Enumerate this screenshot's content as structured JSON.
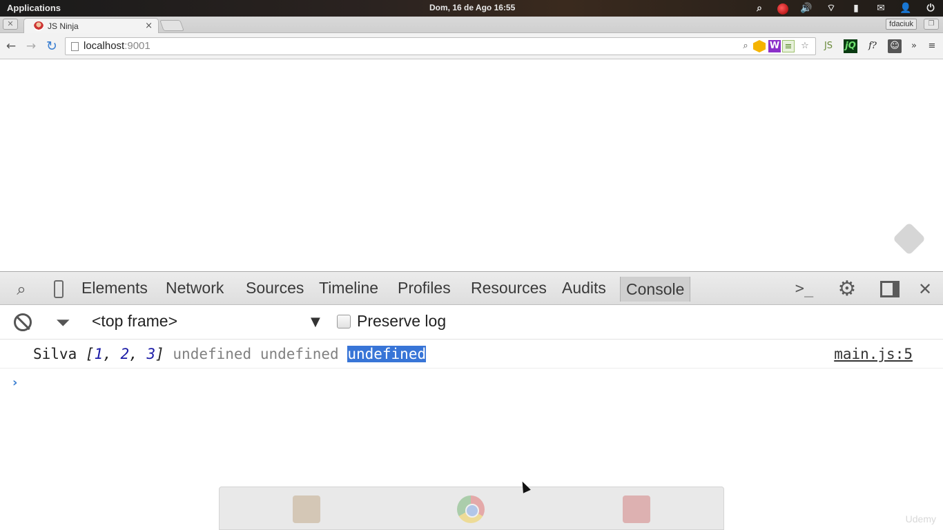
{
  "system_bar": {
    "applications_label": "Applications",
    "clock": "Dom, 16 de Ago 16:55"
  },
  "browser": {
    "tab": {
      "title": "JS Ninja",
      "close_glyph": "×"
    },
    "user_badge": "fdaciuk",
    "address": {
      "host": "localhost",
      "port": ":9001"
    },
    "extensions": {
      "w_label": "W",
      "sheet_label": "≡",
      "js_label": "JS",
      "jq_label": "jQ",
      "f_label": "f?",
      "more_label": "»"
    }
  },
  "devtools": {
    "tabs": [
      "Elements",
      "Network",
      "Sources",
      "Timeline",
      "Profiles",
      "Resources",
      "Audits",
      "Console"
    ],
    "active_tab": "Console",
    "filter_bar": {
      "frame_label": "<top frame>",
      "preserve_log_label": "Preserve log"
    },
    "console": {
      "message": {
        "str": "Silva",
        "array_open": "[",
        "n1": "1",
        "n2": "2",
        "n3": "3",
        "array_close": "]",
        "u1": "undefined",
        "u2": "undefined",
        "u3_selected": "undefined",
        "source": "main.js:5"
      },
      "prompt_glyph": "›"
    }
  },
  "watermark": "Udemy",
  "colors": {
    "selection": "#3875d7",
    "number": "#1a1aa6",
    "undefined_text": "#808080",
    "link_blue": "#3b7fd1"
  }
}
